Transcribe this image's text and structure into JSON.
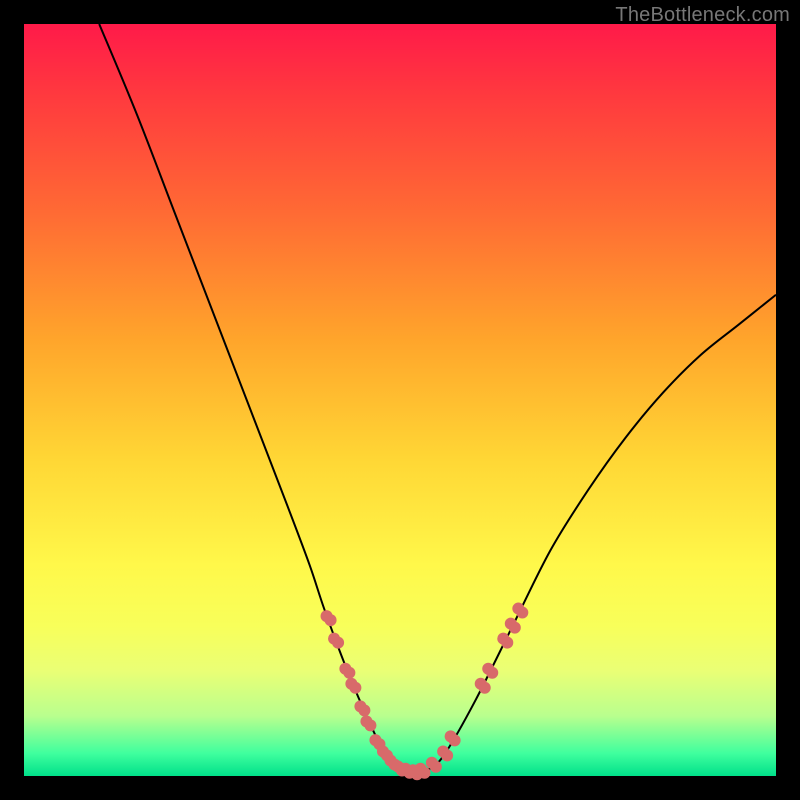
{
  "watermark": "TheBottleneck.com",
  "colors": {
    "frame_bg_top": "#ff1a49",
    "frame_bg_bottom": "#00e08a",
    "curve": "#000000",
    "dots": "#d86a6a",
    "page_bg": "#000000",
    "watermark": "#777777"
  },
  "chart_data": {
    "type": "line",
    "title": "",
    "xlabel": "",
    "ylabel": "",
    "xlim": [
      0,
      100
    ],
    "ylim": [
      0,
      100
    ],
    "series": [
      {
        "name": "curve",
        "x": [
          10,
          15,
          20,
          25,
          30,
          35,
          38,
          40,
          43,
          46,
          48,
          50,
          52,
          54,
          56,
          60,
          65,
          70,
          75,
          80,
          85,
          90,
          95,
          100
        ],
        "y": [
          100,
          88,
          75,
          62,
          49,
          36,
          28,
          22,
          14,
          7,
          3,
          1,
          0.5,
          1,
          3,
          10,
          20,
          30,
          38,
          45,
          51,
          56,
          60,
          64
        ]
      }
    ],
    "markers": [
      {
        "x": 40.5,
        "y": 21
      },
      {
        "x": 41.5,
        "y": 18
      },
      {
        "x": 43.0,
        "y": 14
      },
      {
        "x": 43.8,
        "y": 12
      },
      {
        "x": 45.0,
        "y": 9
      },
      {
        "x": 45.8,
        "y": 7
      },
      {
        "x": 47.0,
        "y": 4.5
      },
      {
        "x": 48.0,
        "y": 3
      },
      {
        "x": 49.0,
        "y": 1.8
      },
      {
        "x": 50.0,
        "y": 1
      },
      {
        "x": 51.0,
        "y": 0.7
      },
      {
        "x": 52.0,
        "y": 0.5
      },
      {
        "x": 53.0,
        "y": 0.7
      },
      {
        "x": 54.5,
        "y": 1.5
      },
      {
        "x": 56.0,
        "y": 3
      },
      {
        "x": 57.0,
        "y": 5
      },
      {
        "x": 61.0,
        "y": 12
      },
      {
        "x": 62.0,
        "y": 14
      },
      {
        "x": 64.0,
        "y": 18
      },
      {
        "x": 65.0,
        "y": 20
      },
      {
        "x": 66.0,
        "y": 22
      }
    ]
  }
}
